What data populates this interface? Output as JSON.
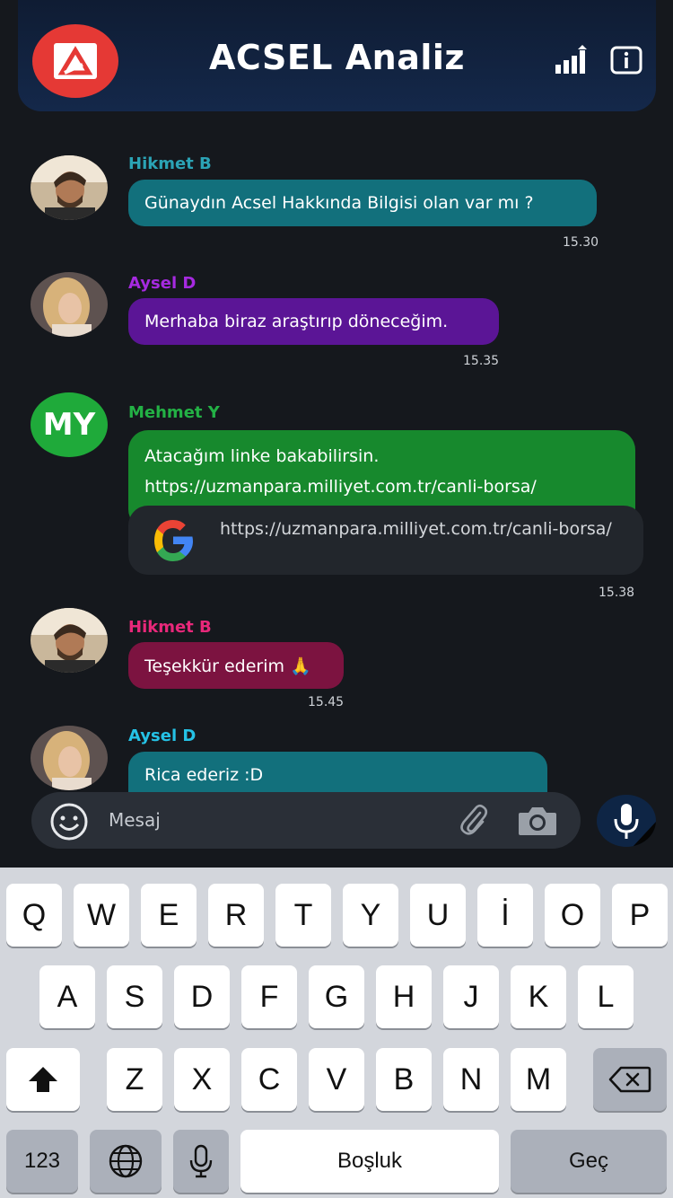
{
  "header": {
    "title": "ACSEL Analiz",
    "colors": {
      "logo_bg": "#e53935",
      "header_bg": "#14284a"
    }
  },
  "messages": [
    {
      "sender": "Hikmet B",
      "sender_color": "#2ba3b5",
      "text": "Günaydın Acsel Hakkında Bilgisi olan var mı ?",
      "bubble_color": "#12707c",
      "time": "15.30"
    },
    {
      "sender": "Aysel D",
      "sender_color": "#a62ae0",
      "text": "Merhaba biraz araştırıp döneceğim.",
      "bubble_color": "#5b1596",
      "time": "15.35"
    },
    {
      "sender": "Mehmet Y",
      "sender_color": "#23b145",
      "avatar_initials": "MY",
      "text_line1": "Atacağım linke bakabilirsin.",
      "text_line2": "https://uzmanpara.milliyet.com.tr/canli-borsa/",
      "bubble_color": "#17892d",
      "link_preview": "https://uzmanpara.milliyet.com.tr/canli-borsa/",
      "time": "15.38"
    },
    {
      "sender": "Hikmet B",
      "sender_color": "#e8287a",
      "text": "Teşekkür ederim 🙏",
      "bubble_color": "#7c1340",
      "time": "15.45"
    },
    {
      "sender": "Aysel D",
      "sender_color": "#25c2e6",
      "text": "Rica ederiz :D",
      "bubble_color": "#12707c"
    }
  ],
  "input": {
    "placeholder": "Mesaj"
  },
  "keyboard": {
    "row1": [
      "Q",
      "W",
      "E",
      "R",
      "T",
      "Y",
      "U",
      "İ",
      "O",
      "P"
    ],
    "row2": [
      "A",
      "S",
      "D",
      "F",
      "G",
      "H",
      "J",
      "K",
      "L"
    ],
    "row3": [
      "Z",
      "X",
      "C",
      "V",
      "B",
      "N",
      "M"
    ],
    "numbers_key": "123",
    "space_key": "Boşluk",
    "return_key": "Geç"
  },
  "icons": [
    "logo-icon",
    "bar-chart-icon",
    "info-icon",
    "google-icon",
    "emoji-icon",
    "paperclip-icon",
    "camera-icon",
    "microphone-icon",
    "shift-icon",
    "backspace-icon",
    "globe-icon",
    "keyboard-mic-icon"
  ]
}
